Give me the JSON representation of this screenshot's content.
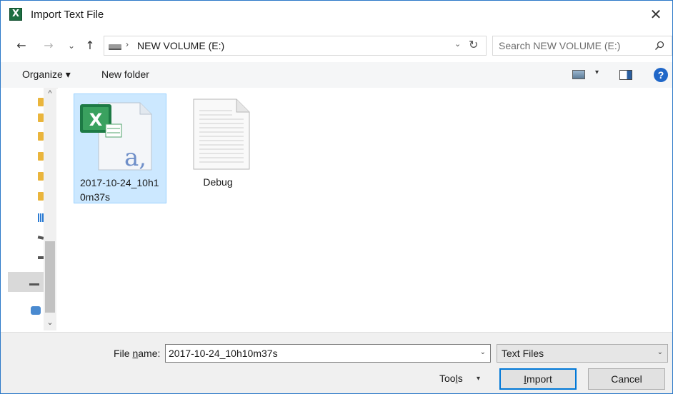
{
  "window": {
    "title": "Import Text File",
    "close_glyph": "✕",
    "app_icon": "excel-icon",
    "app_icon_letter": "X"
  },
  "nav": {
    "back_glyph": "←",
    "forward_glyph": "→",
    "recent_glyph": "⌄",
    "up_glyph": "↑",
    "breadcrumb_sep": "›",
    "location": "NEW VOLUME (E:)",
    "address_dropdown_glyph": "⌄",
    "refresh_glyph": "↻",
    "search_placeholder": "Search NEW VOLUME (E:)"
  },
  "commands": {
    "organize": "Organize ▾",
    "new_folder": "New folder",
    "view_dropdown_glyph": "▾",
    "help_glyph": "?"
  },
  "navpane": {
    "scroll_up_glyph": "^",
    "scroll_down_glyph": "⌄",
    "items": [
      "folder",
      "folder",
      "folder",
      "folder",
      "folder",
      "folder",
      "network-grid",
      "drive",
      "drive",
      "drive",
      "network"
    ]
  },
  "files": [
    {
      "name": "2017-10-24_10h10m37s",
      "line1": "2017-10-24_10h1",
      "line2": "0m37s",
      "type": "excel-csv",
      "selected": true
    },
    {
      "name": "Debug",
      "line1": "Debug",
      "line2": "",
      "type": "text-document",
      "selected": false
    }
  ],
  "footer": {
    "file_name_label_pre": "File ",
    "file_name_label_u": "n",
    "file_name_label_post": "ame:",
    "file_name_value": "2017-10-24_10h10m37s",
    "file_type": "Text Files",
    "dropdown_glyph": "⌄",
    "tools_pre": "Too",
    "tools_u": "l",
    "tools_post": "s",
    "tools_dd": "▾",
    "import_u": "I",
    "import_post": "mport",
    "cancel": "Cancel"
  },
  "colors": {
    "accent": "#0078d7",
    "selection": "#cce8ff",
    "excel_green": "#1d6f42"
  }
}
